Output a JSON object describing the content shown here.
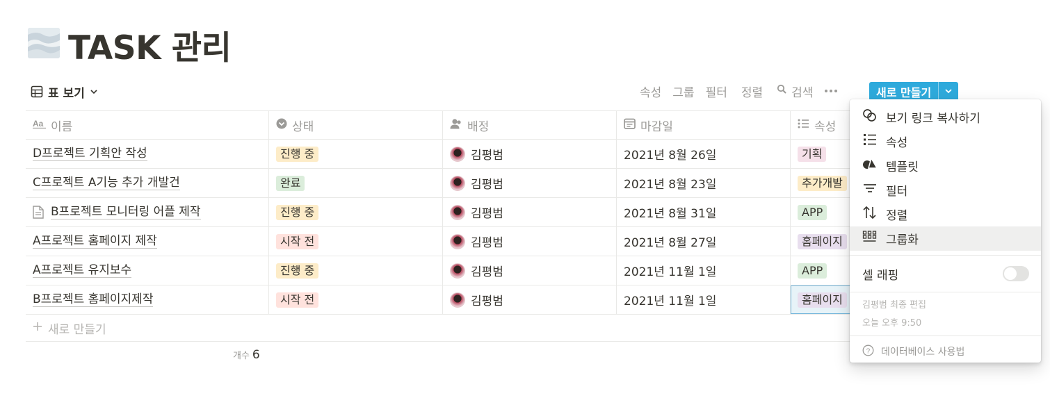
{
  "page": {
    "title": "TASK 관리",
    "icon": "sky-banner-icon"
  },
  "view": {
    "label": "표 보기"
  },
  "toolbar": {
    "properties": "속성",
    "group": "그룹",
    "filter": "필터",
    "sort": "정렬",
    "search": "검색",
    "new_button": "새로 만들기"
  },
  "table": {
    "columns": [
      {
        "label": "이름",
        "icon": "text-aa-icon"
      },
      {
        "label": "상태",
        "icon": "status-icon"
      },
      {
        "label": "배정",
        "icon": "person-icon"
      },
      {
        "label": "마감일",
        "icon": "calendar-icon"
      },
      {
        "label": "속성",
        "icon": "list-icon"
      }
    ],
    "rows": [
      {
        "name": "D프로젝트 기획안 작성",
        "status": "진행 중",
        "assignee": "김평범",
        "due": "2021년 8월 26일",
        "attr": "기획"
      },
      {
        "name": "C프로젝트 A기능 추가 개발건",
        "status": "완료",
        "assignee": "김평범",
        "due": "2021년 8월 23일",
        "attr": "추가개발"
      },
      {
        "name": "B프로젝트 모니터링 어플 제작",
        "status": "진행 중",
        "assignee": "김평범",
        "due": "2021년 8월 31일",
        "attr": "APP"
      },
      {
        "name": "A프로젝트 홈페이지 제작",
        "status": "시작 전",
        "assignee": "김평범",
        "due": "2021년 8월 27일",
        "attr": "홈페이지"
      },
      {
        "name": "A프로젝트 유지보수",
        "status": "진행 중",
        "assignee": "김평범",
        "due": "2021년 11월 1일",
        "attr": "APP"
      },
      {
        "name": "B프로젝트 홈페이지제작",
        "status": "시작 전",
        "assignee": "김평범",
        "due": "2021년 11월 1일",
        "attr": "홈페이지"
      }
    ],
    "new_row": "새로 만들기",
    "count_label": "개수",
    "count_value": "6"
  },
  "colors": {
    "진행 중": "#fdecc8",
    "완료": "#dbeddb",
    "시작 전": "#ffe2dd",
    "기획": "#f5e0e9",
    "추가개발": "#fdecc8",
    "APP": "#dbeddb",
    "홈페이지": "#e8deee",
    "accent": "#2eaadc"
  },
  "menu": {
    "items": [
      {
        "label": "보기 링크 복사하기",
        "icon": "link-icon"
      },
      {
        "label": "속성",
        "icon": "list-icon"
      },
      {
        "label": "템플릿",
        "icon": "template-shapes-icon"
      },
      {
        "label": "필터",
        "icon": "filter-icon"
      },
      {
        "label": "정렬",
        "icon": "sort-icon"
      },
      {
        "label": "그룹화",
        "icon": "group-grid-icon"
      }
    ],
    "wrap_label": "셀 래핑",
    "edited_by": "김평범 최종 편집",
    "edited_time": "오늘 오후 9:50",
    "help": "데이터베이스 사용법"
  }
}
